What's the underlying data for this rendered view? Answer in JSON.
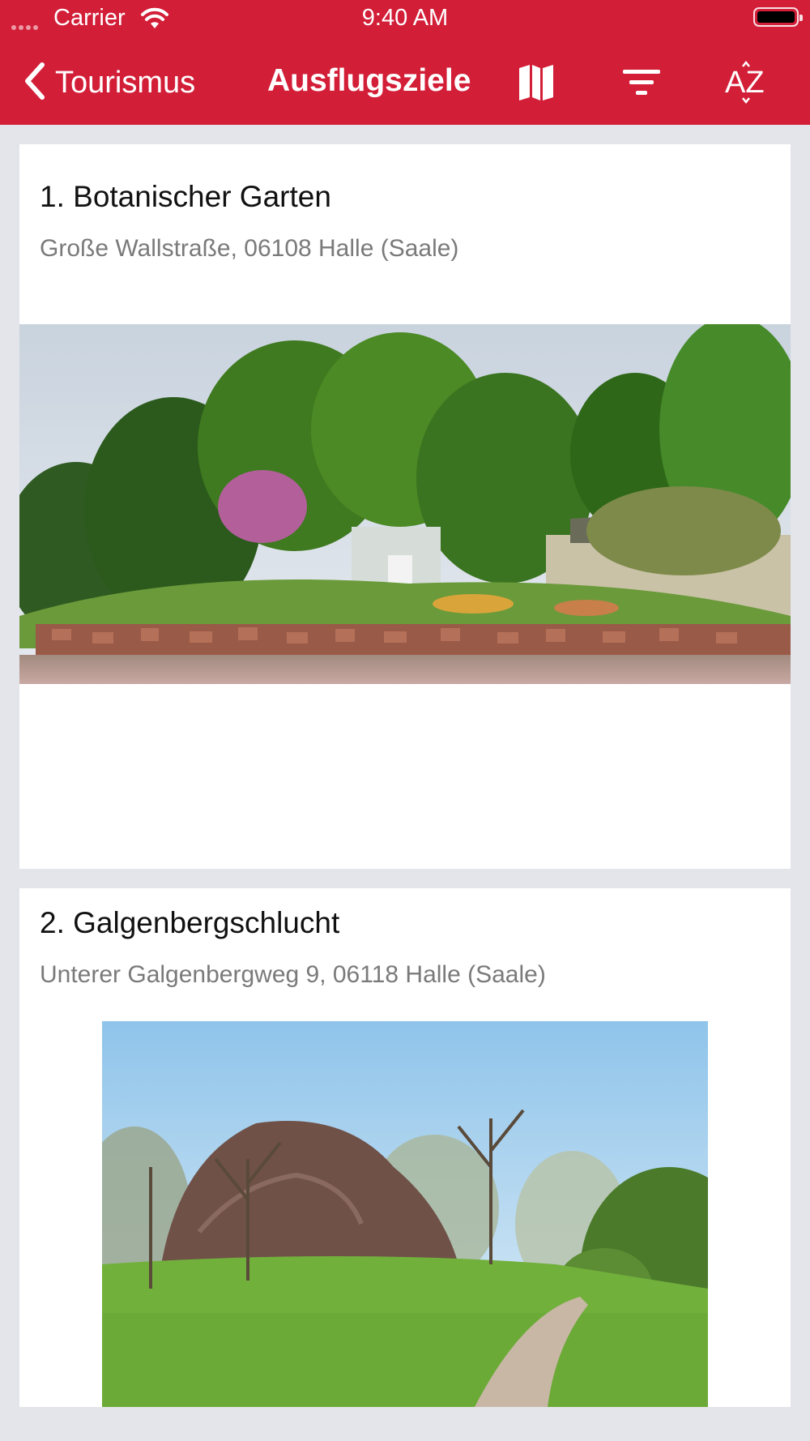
{
  "status_bar": {
    "carrier": "Carrier",
    "time": "9:40 AM"
  },
  "nav": {
    "back_label": "Tourismus",
    "title": "Ausflugsziele",
    "icons": [
      "map-icon",
      "filter-icon",
      "sort-az-icon"
    ],
    "sort_label": "AZ"
  },
  "colors": {
    "accent": "#d31e38",
    "background": "#e4e5ea",
    "card": "#ffffff",
    "subtitle": "#7a7a7a"
  },
  "items": [
    {
      "title": "1. Botanischer Garten",
      "address": "Große Wallstraße, 06108 Halle (Saale)",
      "image": "garden-photo"
    },
    {
      "title": "2. Galgenbergschlucht",
      "address": "Unterer Galgenbergweg 9, 06118 Halle (Saale)",
      "image": "rock-gorge-photo"
    }
  ]
}
